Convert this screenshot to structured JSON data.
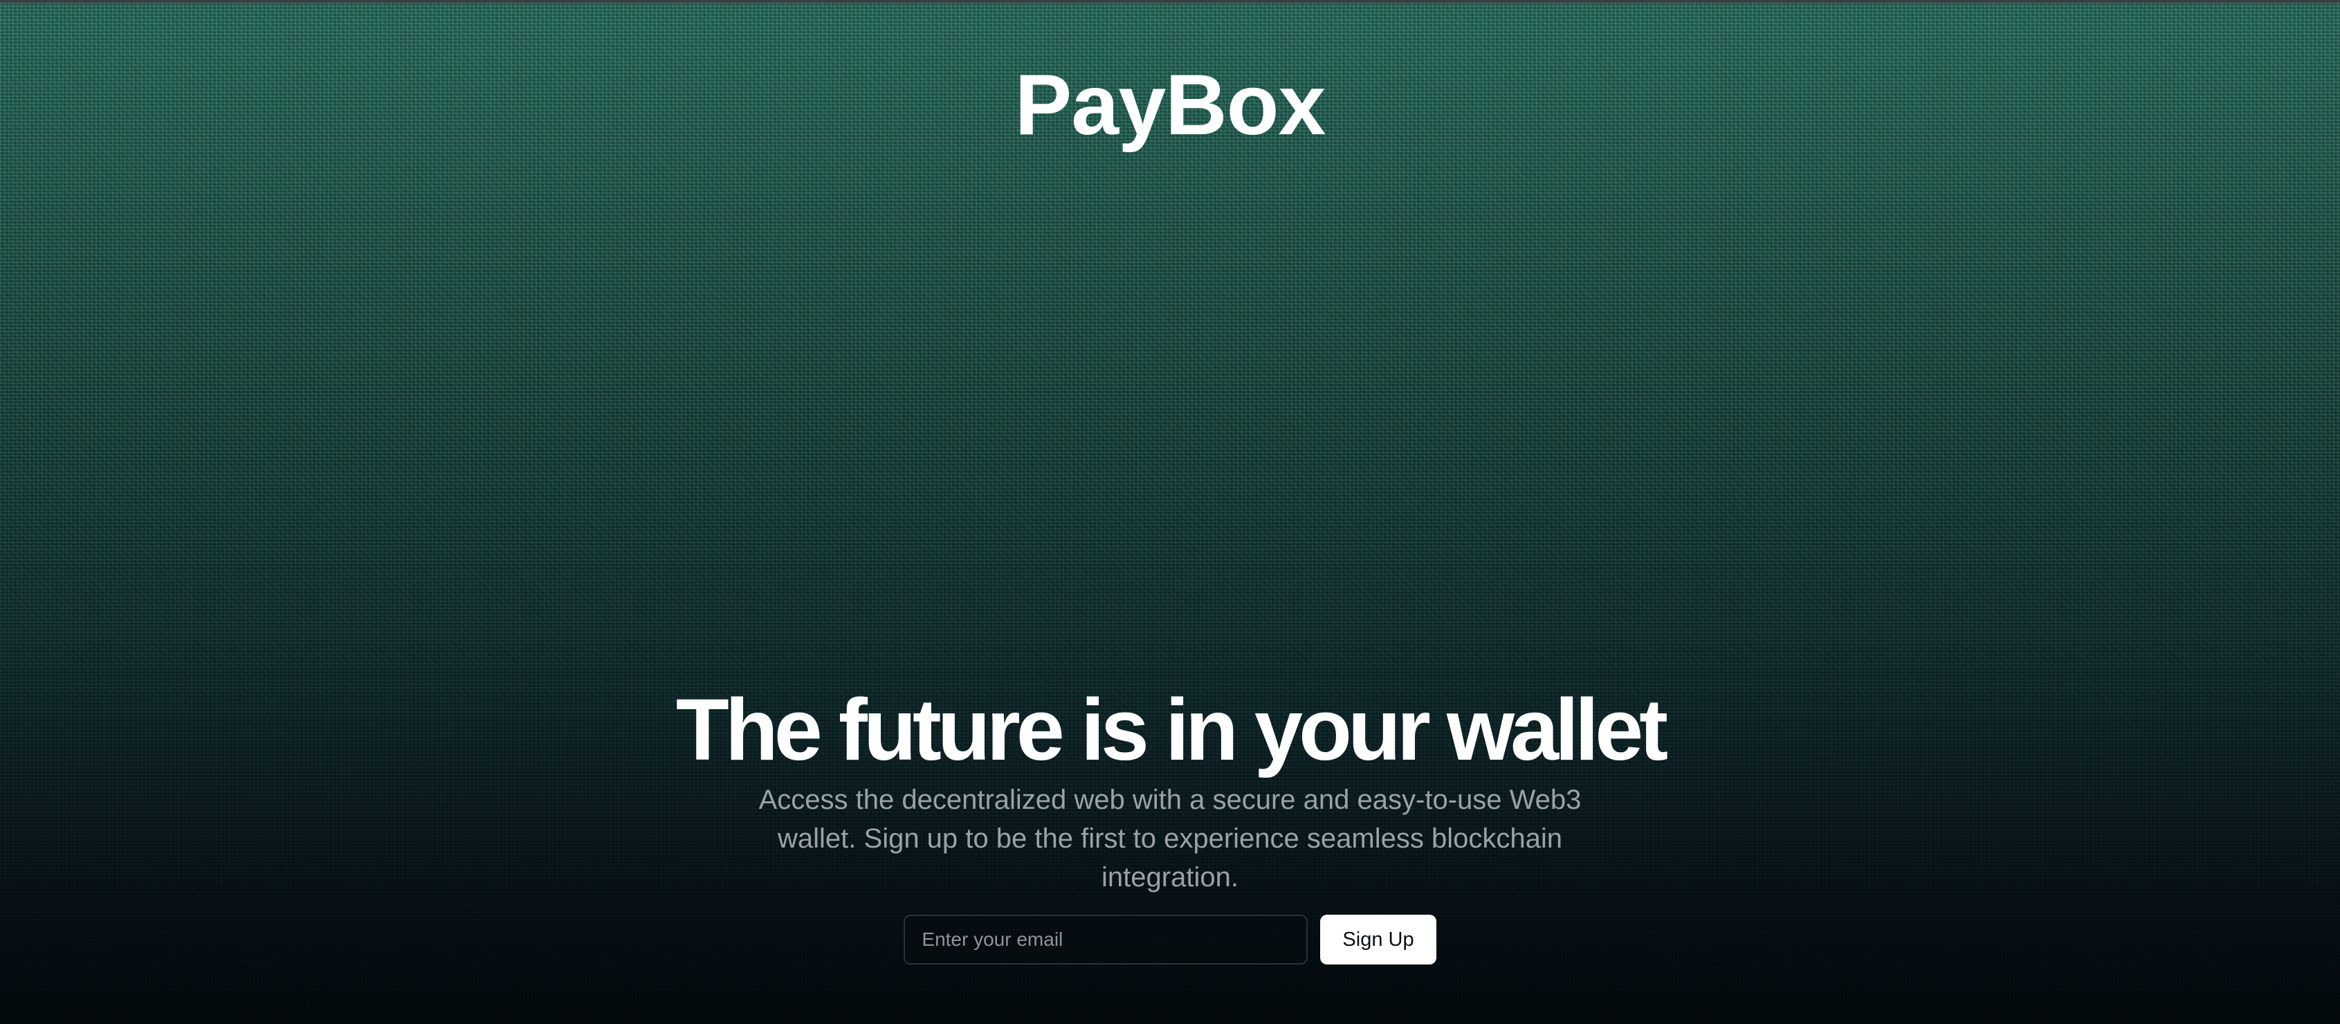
{
  "brand": {
    "name": "PayBox"
  },
  "hero": {
    "headline": "The future is in your wallet",
    "subtext": "Access the decentralized web with a secure and easy-to-use Web3 wallet. Sign up to be the first to experience seamless blockchain integration.",
    "email_input": {
      "placeholder": "Enter your email",
      "value": ""
    },
    "signup_label": "Sign Up"
  },
  "colors": {
    "background_top": "#2a6b5e",
    "background_bottom": "#03080c",
    "text_primary": "#ffffff",
    "text_secondary": "#9aa2a8",
    "button_bg": "#ffffff",
    "button_text": "#0a0f14"
  }
}
